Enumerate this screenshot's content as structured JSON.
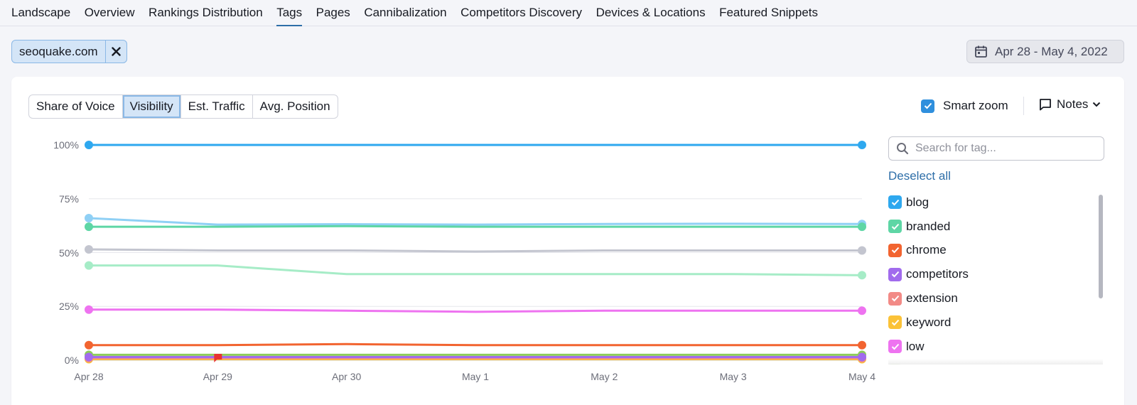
{
  "tabs": [
    {
      "label": "Landscape",
      "active": false
    },
    {
      "label": "Overview",
      "active": false
    },
    {
      "label": "Rankings Distribution",
      "active": false
    },
    {
      "label": "Tags",
      "active": true
    },
    {
      "label": "Pages",
      "active": false
    },
    {
      "label": "Cannibalization",
      "active": false
    },
    {
      "label": "Competitors Discovery",
      "active": false
    },
    {
      "label": "Devices & Locations",
      "active": false
    },
    {
      "label": "Featured Snippets",
      "active": false
    }
  ],
  "domain_filter": {
    "label": "seoquake.com"
  },
  "date_range": {
    "label": "Apr 28 - May 4, 2022"
  },
  "metric_tabs": [
    {
      "label": "Share of Voice",
      "active": false
    },
    {
      "label": "Visibility",
      "active": true
    },
    {
      "label": "Est. Traffic",
      "active": false
    },
    {
      "label": "Avg. Position",
      "active": false
    }
  ],
  "smart_zoom": {
    "label": "Smart zoom",
    "checked": true
  },
  "notes": {
    "label": "Notes"
  },
  "tag_search": {
    "placeholder": "Search for tag..."
  },
  "deselect_all": "Deselect all",
  "colors": {
    "accent": "#2d6ea8",
    "checkbox": "#2f8fdd",
    "note_marker": "#e8332f"
  },
  "chart_data": {
    "type": "line",
    "x": [
      "Apr 28",
      "Apr 29",
      "Apr 30",
      "May 1",
      "May 2",
      "May 3",
      "May 4"
    ],
    "y_ticks": [
      "0%",
      "25%",
      "50%",
      "75%",
      "100%"
    ],
    "ylim": [
      0,
      100
    ],
    "grid": true,
    "series": [
      {
        "name": "blog",
        "color": "#2ea8ef",
        "values": [
          100,
          100,
          100,
          100,
          100,
          100,
          100
        ]
      },
      {
        "name": "branded",
        "color": "#5ed6a5",
        "values": [
          62,
          62,
          62.3,
          62,
          62,
          62,
          62
        ]
      },
      {
        "name": "chrome",
        "color": "#f26430",
        "values": [
          7,
          7,
          7.5,
          7,
          7,
          7,
          7
        ]
      },
      {
        "name": "competitors",
        "color": "#a16bed",
        "values": [
          1.5,
          1.5,
          1.5,
          1.5,
          1.5,
          1.5,
          1.5
        ]
      },
      {
        "name": "extension",
        "color": "#f28a86",
        "values": [
          1,
          1,
          1,
          1,
          1,
          1,
          1
        ]
      },
      {
        "name": "keyword",
        "color": "#fbc238",
        "values": [
          0.5,
          0.5,
          0.5,
          0.5,
          0.5,
          0.5,
          0.5
        ]
      },
      {
        "name": "low",
        "color": "#ee73f0",
        "values": [
          23.5,
          23.5,
          23,
          22.5,
          23,
          23,
          23
        ]
      },
      {
        "name": null,
        "color": "#8fd0f5",
        "values": [
          66,
          63,
          63.2,
          63,
          63.3,
          63.4,
          63.3
        ]
      },
      {
        "name": null,
        "color": "#a6ecc7",
        "values": [
          44,
          44,
          40,
          40,
          40,
          40,
          39.5
        ]
      },
      {
        "name": null,
        "color": "#c3c5cf",
        "values": [
          51.5,
          51,
          51,
          50.5,
          51,
          51,
          51
        ]
      },
      {
        "name": null,
        "color": "#8dcc5a",
        "values": [
          2.5,
          2.5,
          2.5,
          2.5,
          2.5,
          2.5,
          2.5
        ]
      }
    ]
  }
}
